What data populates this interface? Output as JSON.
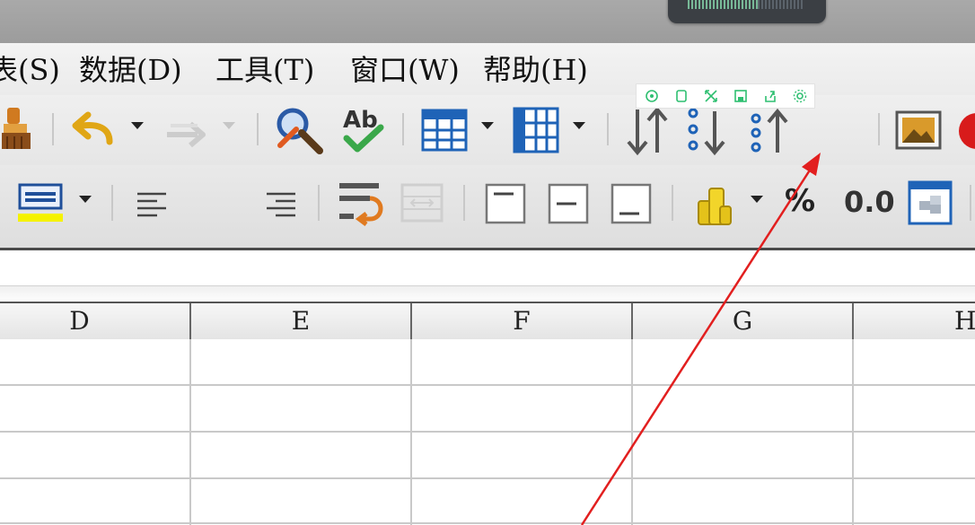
{
  "menubar": {
    "items": [
      {
        "label": "表(S)"
      },
      {
        "label": "数据(D)"
      },
      {
        "label": "工具(T)"
      },
      {
        "label": "窗口(W)"
      },
      {
        "label": "帮助(H)"
      }
    ]
  },
  "toolbar2": {
    "percent_label": "%",
    "decimal_label": "0.0"
  },
  "sheet": {
    "columns": [
      "D",
      "E",
      "F",
      "G",
      "H"
    ]
  },
  "annotation": {
    "arrow_color": "#e21f1f",
    "points_to": "autofilter-button"
  },
  "colors": {
    "filter_highlight": "#c9d5e3",
    "float_toolbar_icon": "#2fbf71"
  }
}
